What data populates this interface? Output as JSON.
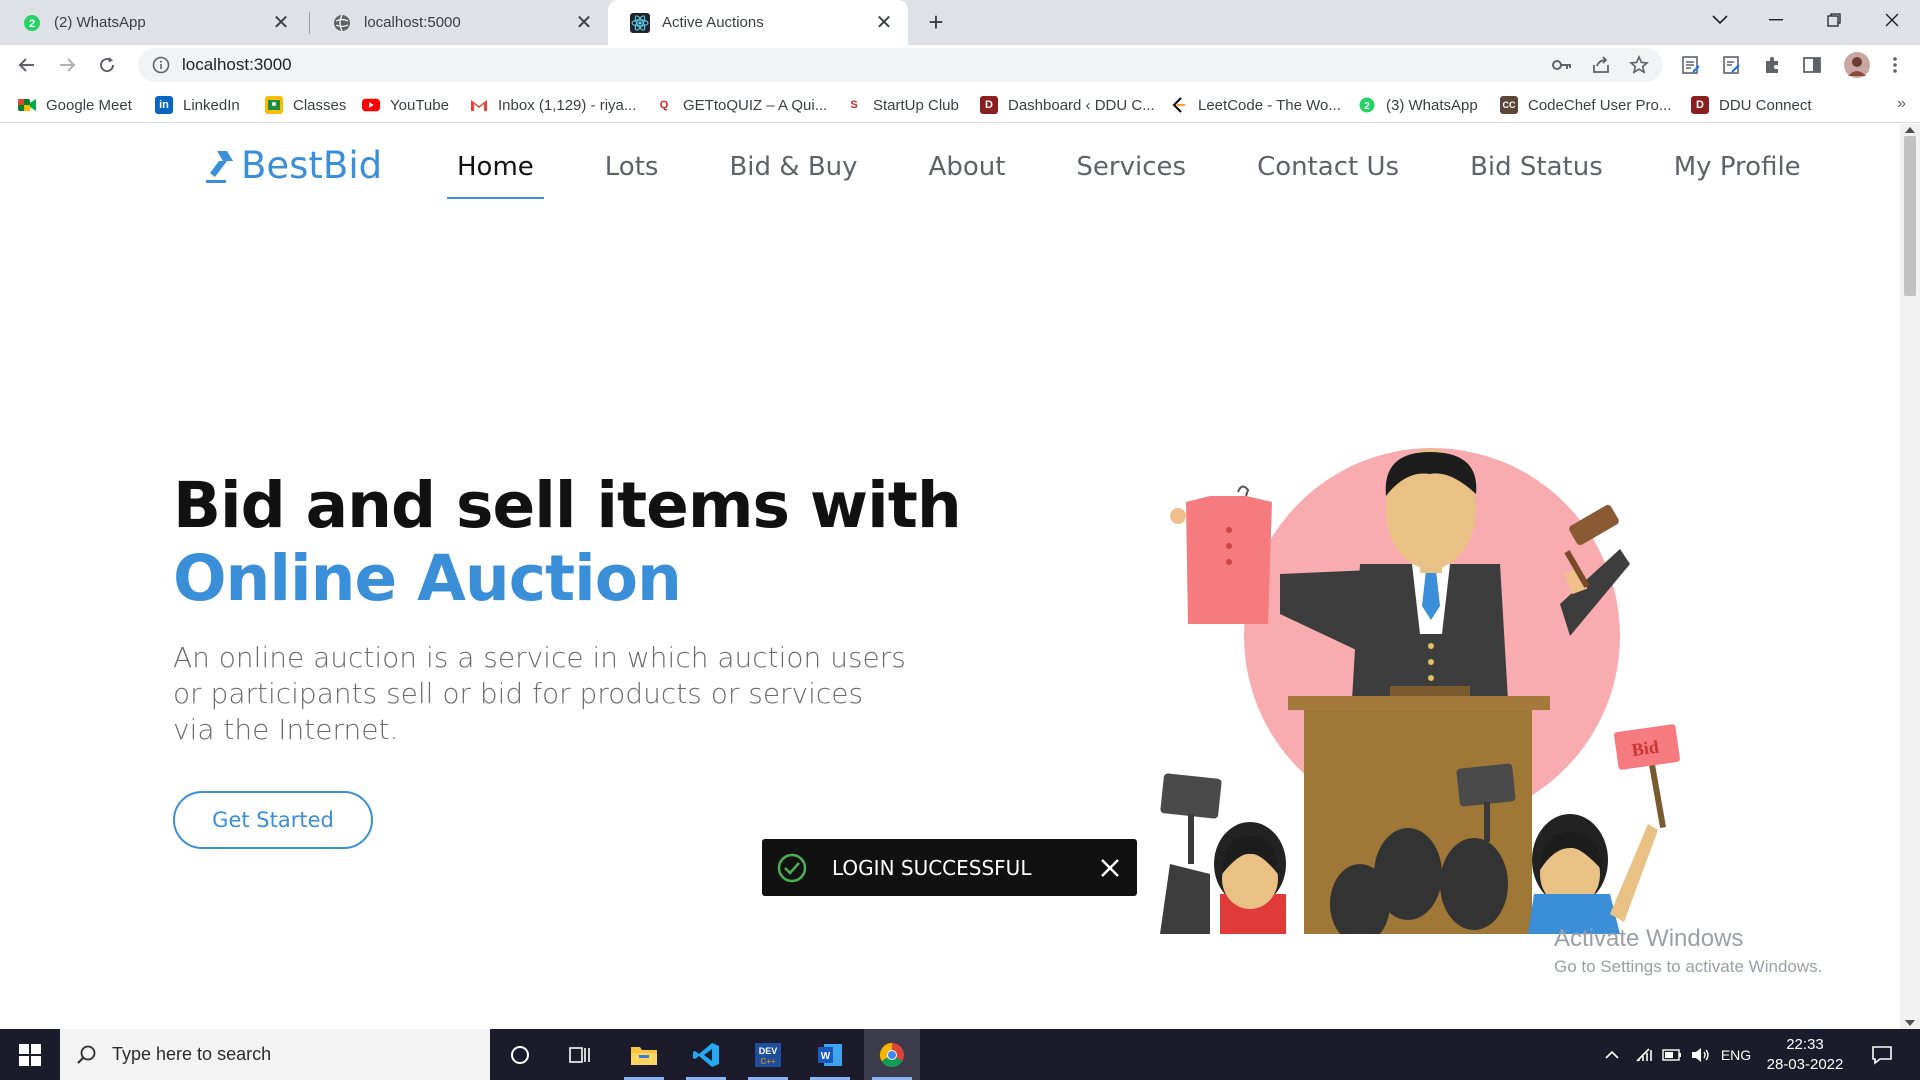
{
  "browser": {
    "tabs": [
      {
        "title": "(2) WhatsApp",
        "icon": "whatsapp-icon",
        "active": false
      },
      {
        "title": "localhost:5000",
        "icon": "globe-icon",
        "active": false
      },
      {
        "title": "Active Auctions",
        "icon": "react-icon",
        "active": true
      }
    ],
    "url": "localhost:3000",
    "bookmarks": [
      {
        "label": "Google Meet",
        "icon": "google-meet-icon"
      },
      {
        "label": "LinkedIn",
        "icon": "linkedin-icon"
      },
      {
        "label": "Classes",
        "icon": "classroom-icon"
      },
      {
        "label": "YouTube",
        "icon": "youtube-icon"
      },
      {
        "label": "Inbox (1,129) - riya...",
        "icon": "gmail-icon"
      },
      {
        "label": "GETtoQUIZ – A Qui...",
        "icon": "quiz-icon"
      },
      {
        "label": "StartUp Club",
        "icon": "startup-club-icon"
      },
      {
        "label": "Dashboard ‹ DDU C...",
        "icon": "ddu-icon"
      },
      {
        "label": "LeetCode - The Wo...",
        "icon": "leetcode-icon"
      },
      {
        "label": "(3) WhatsApp",
        "icon": "whatsapp-icon"
      },
      {
        "label": "CodeChef User Pro...",
        "icon": "codechef-icon"
      },
      {
        "label": "DDU Connect",
        "icon": "ddu-icon"
      }
    ],
    "more_bookmarks": "»"
  },
  "site": {
    "logo": "BestBid",
    "nav": [
      "Home",
      "Lots",
      "Bid & Buy",
      "About",
      "Services",
      "Contact Us",
      "Bid Status",
      "My Profile"
    ],
    "active_nav": "Home",
    "hero": {
      "title_line1": "Bid and sell items with",
      "title_line2": "Online Auction",
      "description": "An online auction is a service in which auction users or participants sell or bid for products or services via the Internet.",
      "cta": "Get Started",
      "sign_text": "Bid"
    },
    "toast": "LOGIN SUCCESSFUL",
    "accent_color": "#3b8fd9"
  },
  "watermark": {
    "line1": "Activate Windows",
    "line2": "Go to Settings to activate Windows."
  },
  "taskbar": {
    "search_placeholder": "Type here to search",
    "language": "ENG",
    "time": "22:33",
    "date": "28-03-2022"
  }
}
